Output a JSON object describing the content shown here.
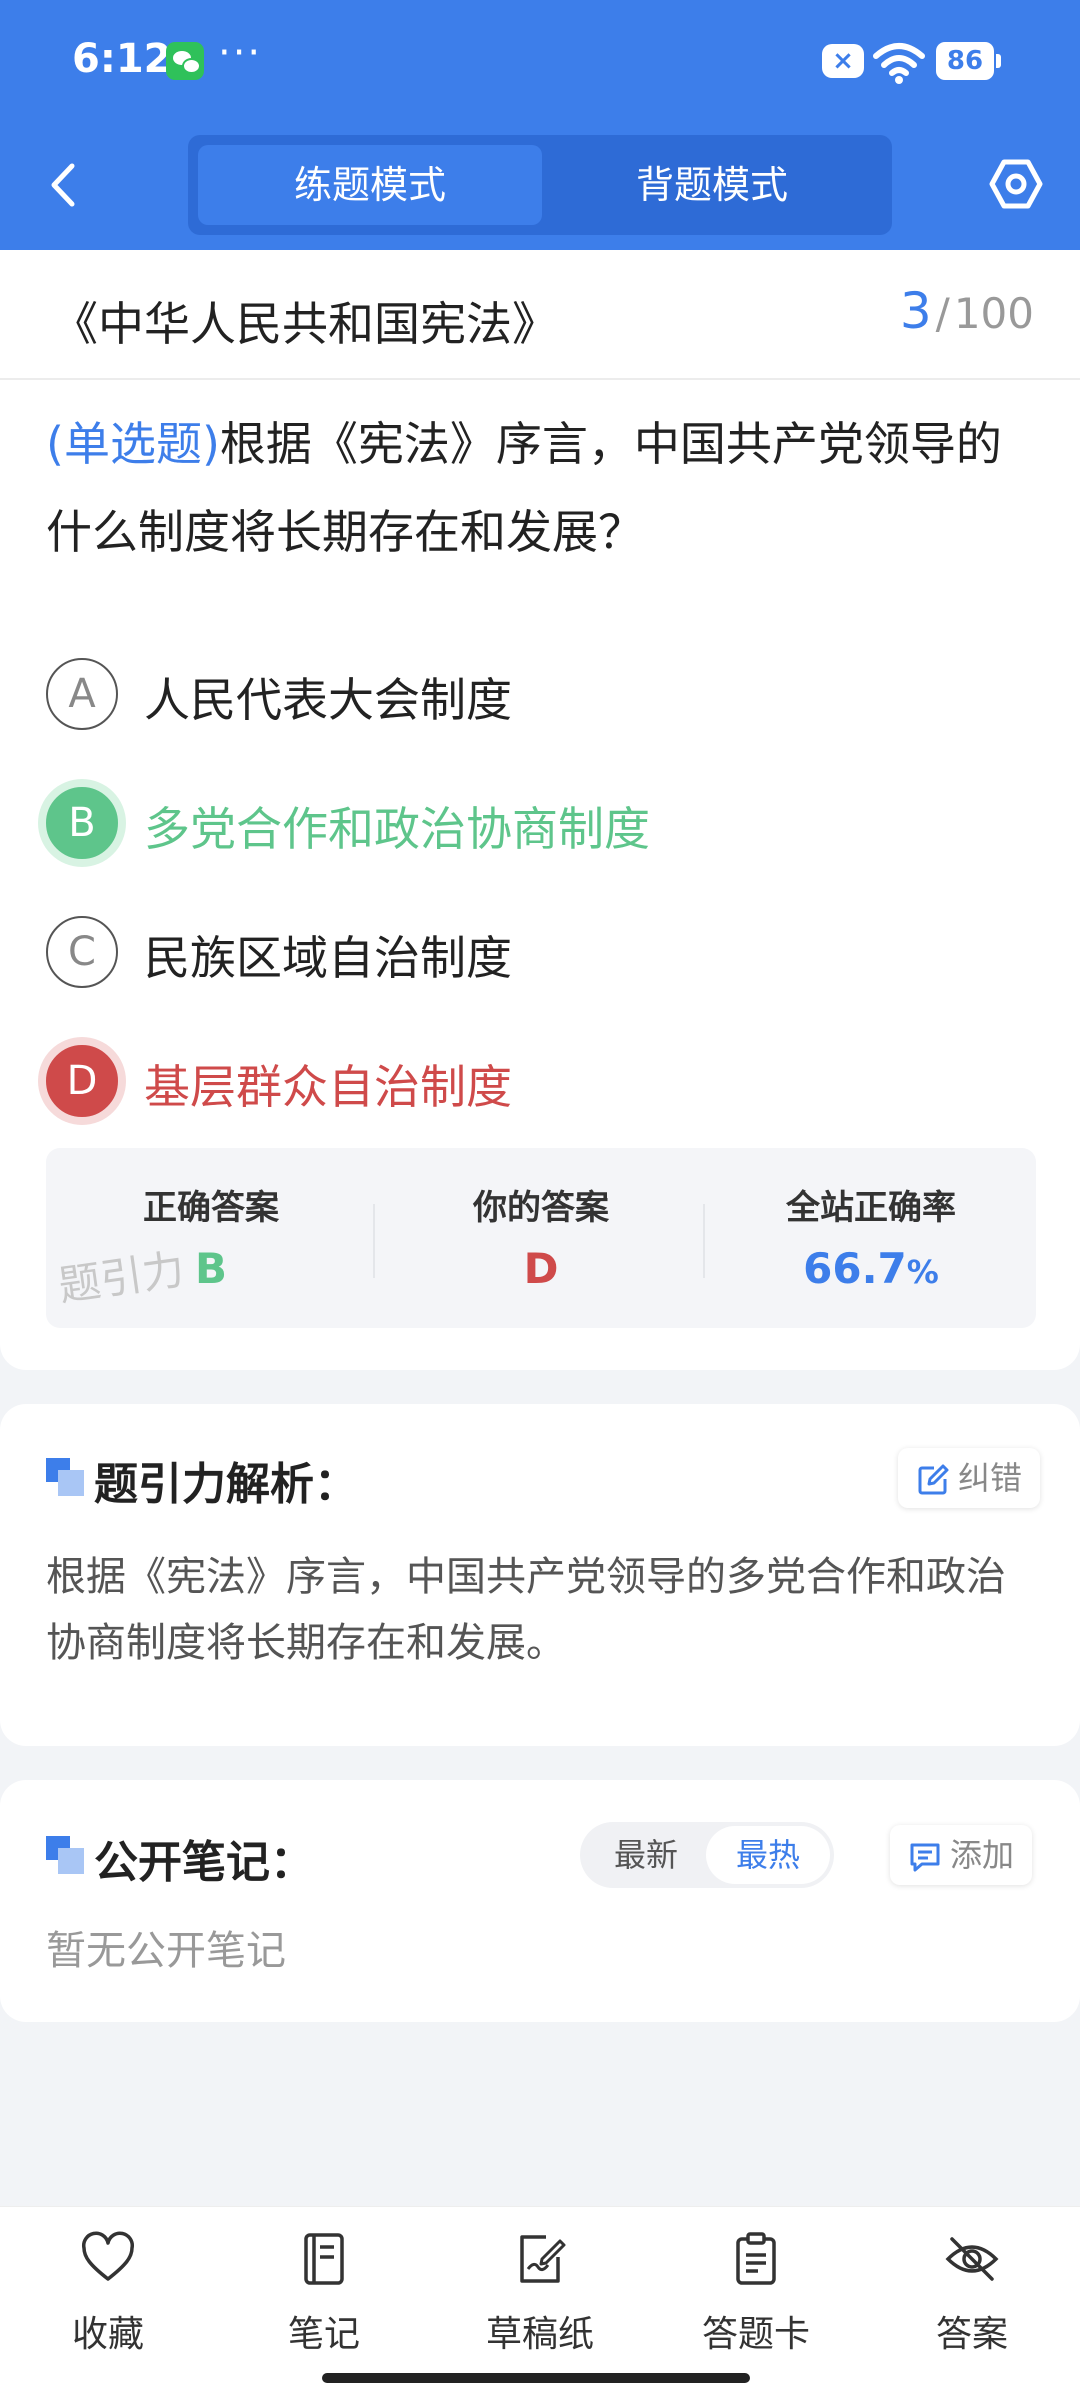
{
  "status_bar": {
    "time": "6:12",
    "dots": "···",
    "battery": "86"
  },
  "header": {
    "modes": [
      "练题模式",
      "背题模式"
    ],
    "active_mode_index": 0,
    "accent_color": "#3d7eea"
  },
  "question_card": {
    "book_title": "《中华人民共和国宪法》",
    "current": "3",
    "separator": "/",
    "total": "100",
    "question_type": "(单选题)",
    "question_text": "根据《宪法》序言，中国共产党领导的什么制度将长期存在和发展？",
    "options": [
      {
        "letter": "A",
        "text": "人民代表大会制度",
        "state": "normal"
      },
      {
        "letter": "B",
        "text": "多党合作和政治协商制度",
        "state": "correct"
      },
      {
        "letter": "C",
        "text": "民族区域自治制度",
        "state": "normal"
      },
      {
        "letter": "D",
        "text": "基层群众自治制度",
        "state": "wrong"
      }
    ],
    "answers": {
      "correct_label": "正确答案",
      "correct_value": "B",
      "yours_label": "你的答案",
      "yours_value": "D",
      "rate_label": "全站正确率",
      "rate_value": "66.7",
      "rate_unit": "%"
    },
    "watermark": "题引力",
    "colors": {
      "correct": "#5ec58b",
      "wrong": "#cf4a4a"
    }
  },
  "analysis": {
    "title": "题引力解析：",
    "report_label": "纠错",
    "text": "根据《宪法》序言，中国共产党领导的多党合作和政治协商制度将长期存在和发展。"
  },
  "notes": {
    "title": "公开笔记：",
    "sort_options": [
      "最新",
      "最热"
    ],
    "active_sort_index": 1,
    "add_label": "添加",
    "empty_text": "暂无公开笔记"
  },
  "bottom_nav": [
    {
      "label": "收藏",
      "icon": "heart-icon"
    },
    {
      "label": "笔记",
      "icon": "notebook-icon"
    },
    {
      "label": "草稿纸",
      "icon": "draft-icon"
    },
    {
      "label": "答题卡",
      "icon": "clipboard-icon"
    },
    {
      "label": "答案",
      "icon": "eye-off-icon"
    }
  ]
}
